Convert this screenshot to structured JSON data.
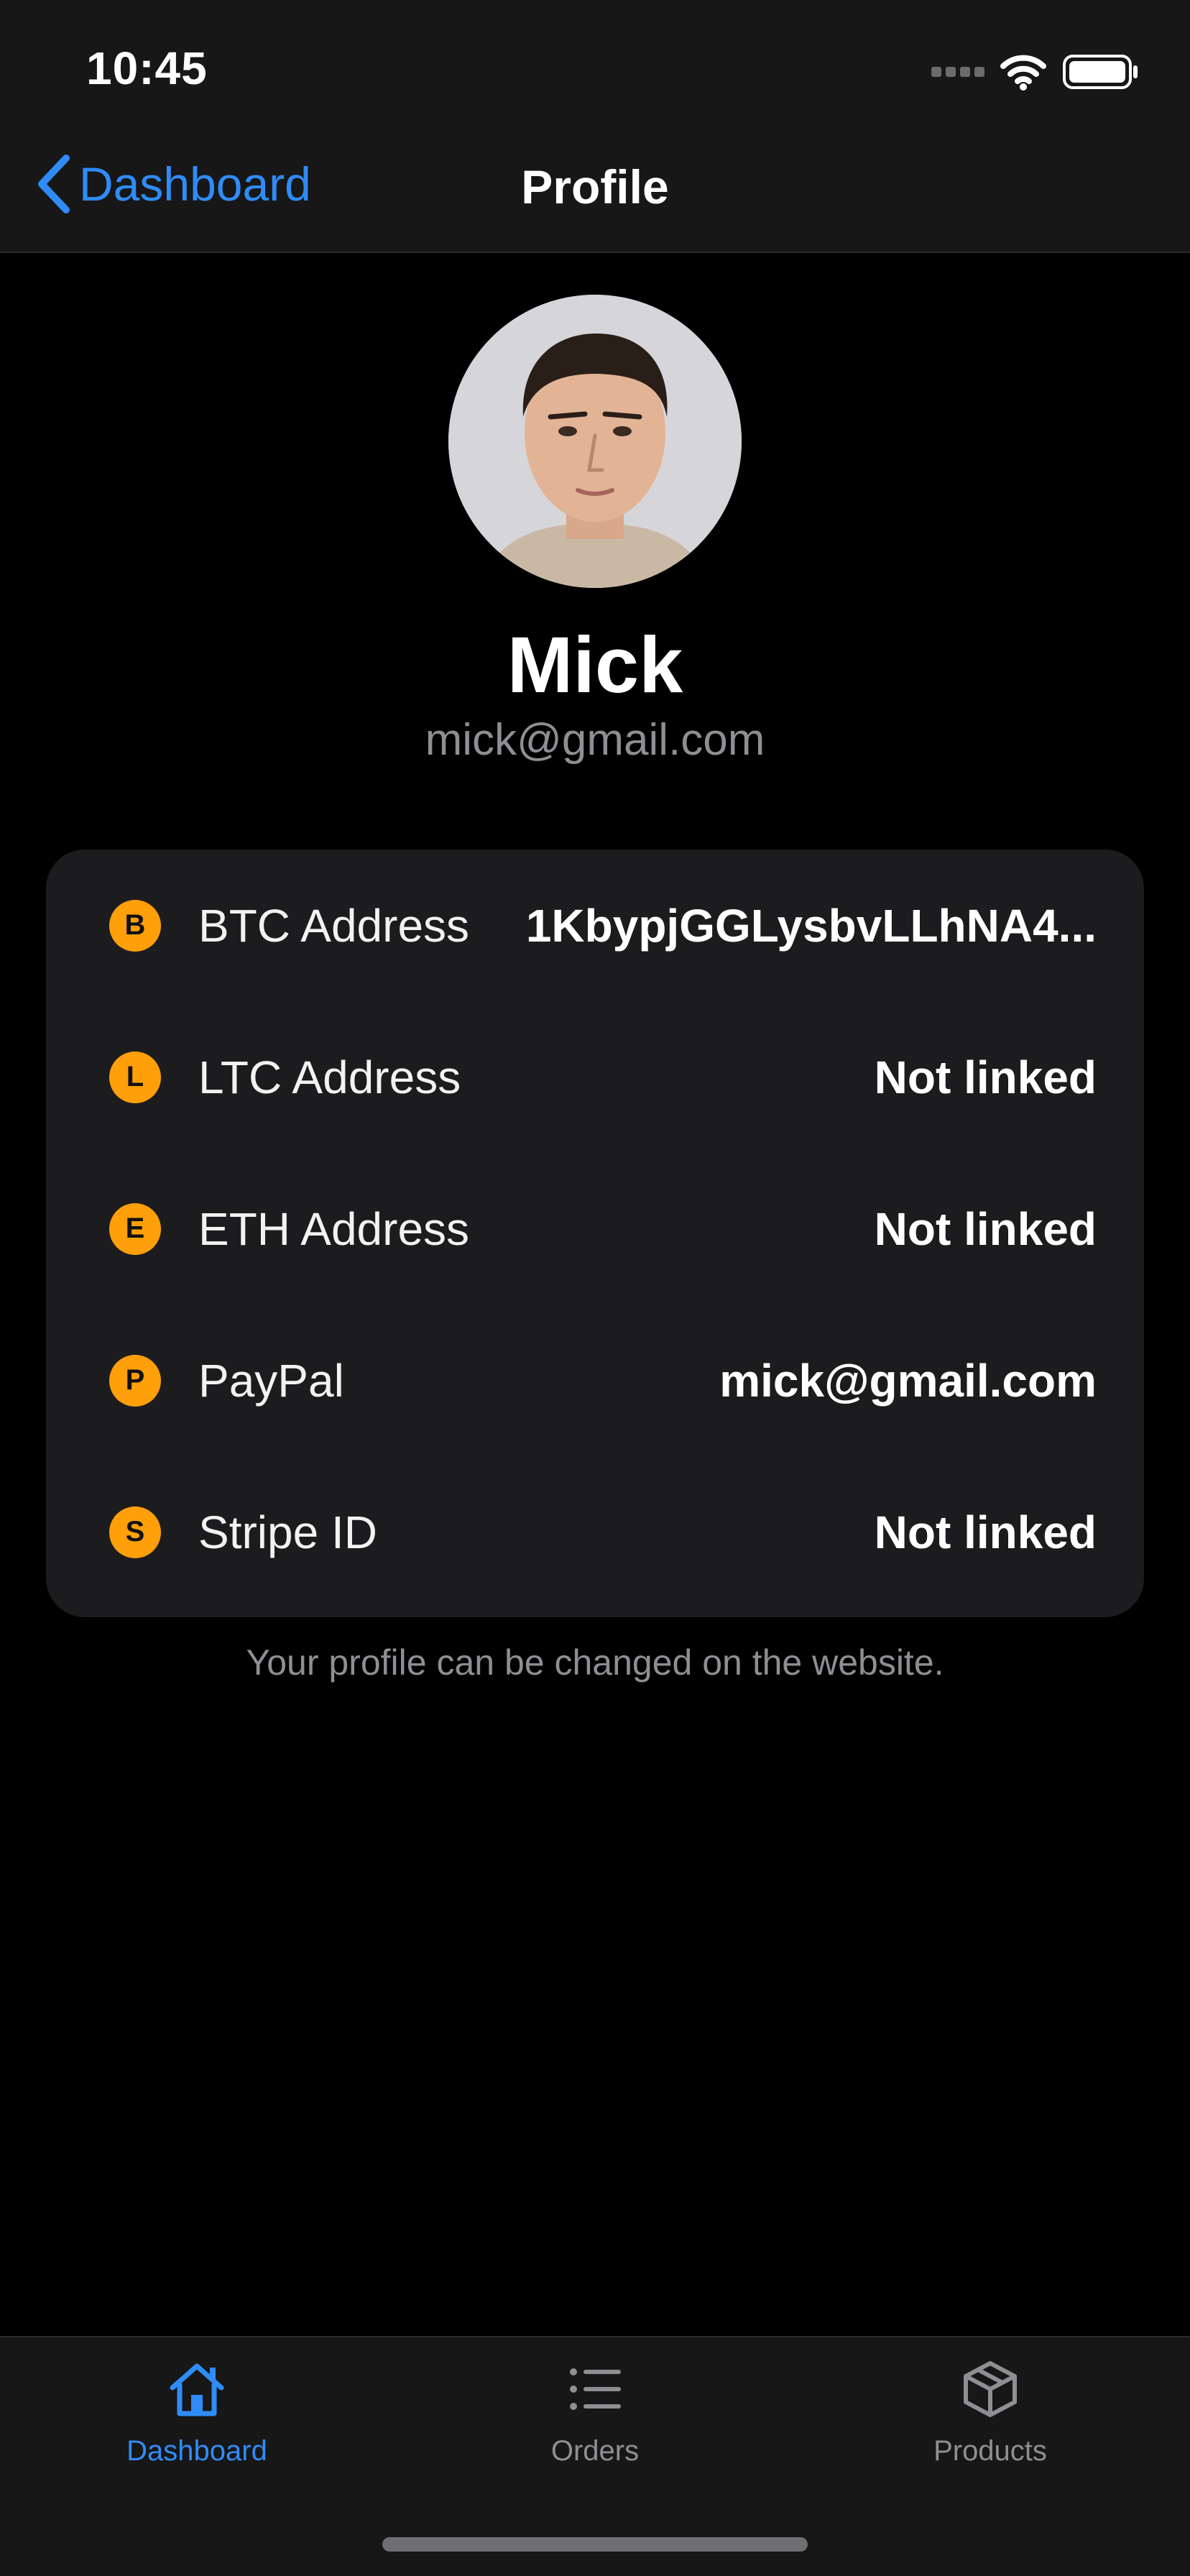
{
  "status_bar": {
    "time": "10:45"
  },
  "nav": {
    "back_label": "Dashboard",
    "title": "Profile"
  },
  "profile": {
    "name": "Mick",
    "email": "mick@gmail.com"
  },
  "accounts": [
    {
      "icon_letter": "B",
      "icon": "bitcoin-icon",
      "label": "BTC Address",
      "value": "1KbypjGGLysbvLLhNA4..."
    },
    {
      "icon_letter": "L",
      "icon": "litecoin-icon",
      "label": "LTC Address",
      "value": "Not linked"
    },
    {
      "icon_letter": "E",
      "icon": "ethereum-icon",
      "label": "ETH Address",
      "value": "Not linked"
    },
    {
      "icon_letter": "P",
      "icon": "paypal-icon",
      "label": "PayPal",
      "value": "mick@gmail.com"
    },
    {
      "icon_letter": "S",
      "icon": "stripe-icon",
      "label": "Stripe ID",
      "value": "Not linked"
    }
  ],
  "footer_note": "Your profile can be changed on the website.",
  "tabs": [
    {
      "label": "Dashboard",
      "icon": "house-icon",
      "active": true
    },
    {
      "label": "Orders",
      "icon": "list-icon",
      "active": false
    },
    {
      "label": "Products",
      "icon": "box-icon",
      "active": false
    }
  ],
  "colors": {
    "accent": "#2f8cf7",
    "coin": "#ff9f0a",
    "card": "#1c1c1e",
    "background": "#000000",
    "secondary_text": "#8e8e93"
  }
}
